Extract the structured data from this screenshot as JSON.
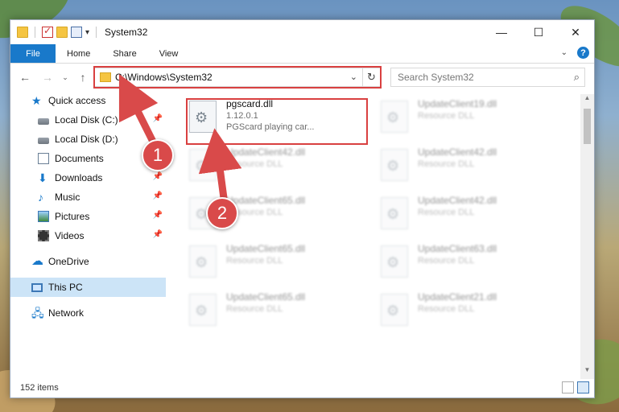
{
  "window": {
    "title": "System32",
    "controls": {
      "minimize": "—",
      "maximize": "☐",
      "close": "✕"
    }
  },
  "ribbon": {
    "tabs": [
      {
        "label": "File"
      },
      {
        "label": "Home"
      },
      {
        "label": "Share"
      },
      {
        "label": "View"
      }
    ],
    "collapse_icon": "chevron-down-icon",
    "help_label": "?"
  },
  "address": {
    "path": "C:\\Windows\\System32",
    "search_placeholder": "Search System32"
  },
  "sidebar": {
    "items": [
      {
        "label": "Quick access",
        "icon": "star-icon",
        "pinned": false
      },
      {
        "label": "Local Disk (C:)",
        "icon": "disk-icon",
        "pinned": true
      },
      {
        "label": "Local Disk (D:)",
        "icon": "disk-icon",
        "pinned": false
      },
      {
        "label": "Documents",
        "icon": "document-icon",
        "pinned": false
      },
      {
        "label": "Downloads",
        "icon": "download-icon",
        "pinned": true
      },
      {
        "label": "Music",
        "icon": "music-icon",
        "pinned": true
      },
      {
        "label": "Pictures",
        "icon": "pictures-icon",
        "pinned": true
      },
      {
        "label": "Videos",
        "icon": "videos-icon",
        "pinned": true
      },
      {
        "label": "OneDrive",
        "icon": "cloud-icon",
        "pinned": false
      },
      {
        "label": "This PC",
        "icon": "computer-icon",
        "pinned": false,
        "selected": true
      },
      {
        "label": "Network",
        "icon": "network-icon",
        "pinned": false
      }
    ]
  },
  "files": [
    {
      "name": "pgscard.dll",
      "version": "1.12.0.1",
      "description": "PGScard playing car...",
      "highlighted": true
    },
    {
      "name": "UpdateClient19.dll",
      "description": "Resource DLL"
    },
    {
      "name": "UpdateClient42.dll",
      "description": "Resource DLL"
    },
    {
      "name": "UpdateClient42.dll",
      "description": "Resource DLL"
    },
    {
      "name": "UpdateClient65.dll",
      "description": "Resource DLL"
    },
    {
      "name": "UpdateClient42.dll",
      "description": "Resource DLL"
    },
    {
      "name": "UpdateClient65.dll",
      "description": "Resource DLL"
    },
    {
      "name": "UpdateClient63.dll",
      "description": "Resource DLL"
    },
    {
      "name": "UpdateClient65.dll",
      "description": "Resource DLL"
    },
    {
      "name": "UpdateClient21.dll",
      "description": "Resource DLL"
    }
  ],
  "status": {
    "item_count": "152 items"
  },
  "annotations": [
    {
      "label": "1"
    },
    {
      "label": "2"
    }
  ],
  "colors": {
    "accent": "#1979ca",
    "highlight": "#d94040",
    "selection": "#cce4f7"
  }
}
